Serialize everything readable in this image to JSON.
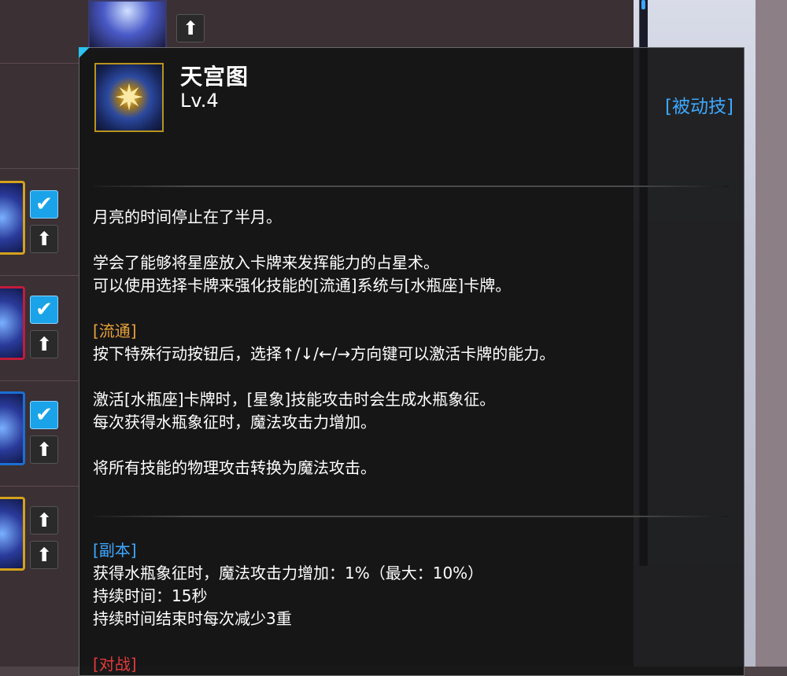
{
  "skill": {
    "name": "天宫图",
    "level": "Lv.4",
    "type": "[被动技]",
    "icon": "horoscope-compass-icon"
  },
  "description": {
    "flavor": "月亮的时间停止在了半月。",
    "line1": "学会了能够将星座放入卡牌来发挥能力的占星术。",
    "line2": "可以使用选择卡牌来强化技能的[流通]系统与[水瓶座]卡牌。",
    "flow_title": "[流通]",
    "flow_text": "按下特殊行动按钮后，选择↑/↓/←/→方向键可以激活卡牌的能力。",
    "aquarius_1": "激活[水瓶座]卡牌时，[星象]技能攻击时会生成水瓶象征。",
    "aquarius_2": "每次获得水瓶象征时，魔法攻击力增加。",
    "convert": "将所有技能的物理攻击转换为魔法攻击。"
  },
  "dungeon": {
    "title": "[副本]",
    "line1": "获得水瓶象征时，魔法攻击力增加：1%（最大：10%）",
    "line2": "持续时间：15秒",
    "line3": "持续时间结束时每次减少3重"
  },
  "pvp": {
    "title": "[对战]"
  },
  "background": {
    "check_glyph": "✔",
    "up_glyph": "⬆"
  },
  "colors": {
    "gold": "#e8a23a",
    "blue": "#3da8ff",
    "red": "#e23a3a",
    "accent": "#2cc3f0"
  }
}
